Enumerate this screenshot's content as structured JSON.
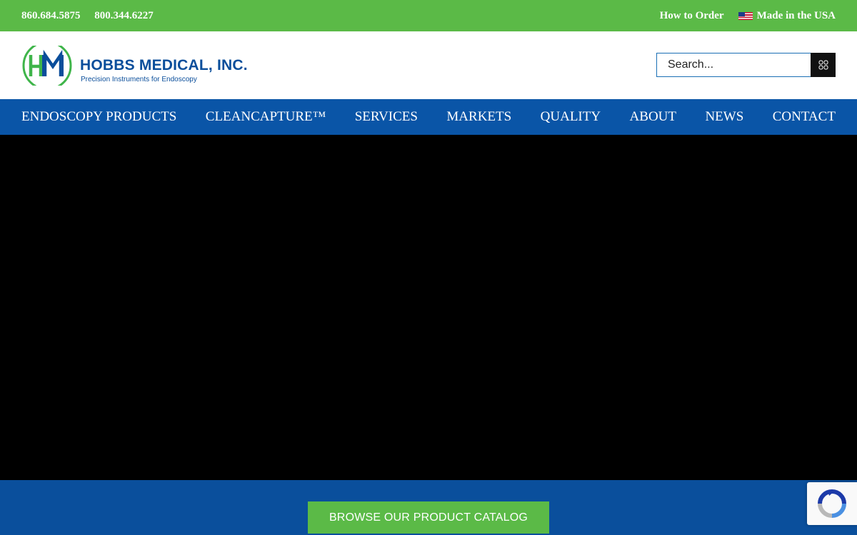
{
  "topbar": {
    "phone1": "860.684.5875",
    "phone2": "800.344.6227",
    "how_to_order": "How to Order",
    "made_in_usa": "Made in the USA"
  },
  "logo": {
    "name": "HOBBS MEDICAL, INC.",
    "tagline": "Precision Instruments for Endoscopy"
  },
  "search": {
    "placeholder": "Search..."
  },
  "nav": {
    "items": [
      {
        "label": "ENDOSCOPY PRODUCTS"
      },
      {
        "label": "CLEANCAPTURE™"
      },
      {
        "label": "SERVICES"
      },
      {
        "label": "MARKETS"
      },
      {
        "label": "QUALITY"
      },
      {
        "label": "ABOUT"
      },
      {
        "label": "NEWS"
      },
      {
        "label": "CONTACT"
      }
    ]
  },
  "cta": {
    "label": "BROWSE OUR PRODUCT CATALOG"
  },
  "colors": {
    "green": "#5bba47",
    "blue": "#0a55a7",
    "dark_blue": "#0a4f9c"
  },
  "icons": {
    "search": "search-icon",
    "flag": "us-flag-icon",
    "recaptcha": "recaptcha-icon"
  }
}
